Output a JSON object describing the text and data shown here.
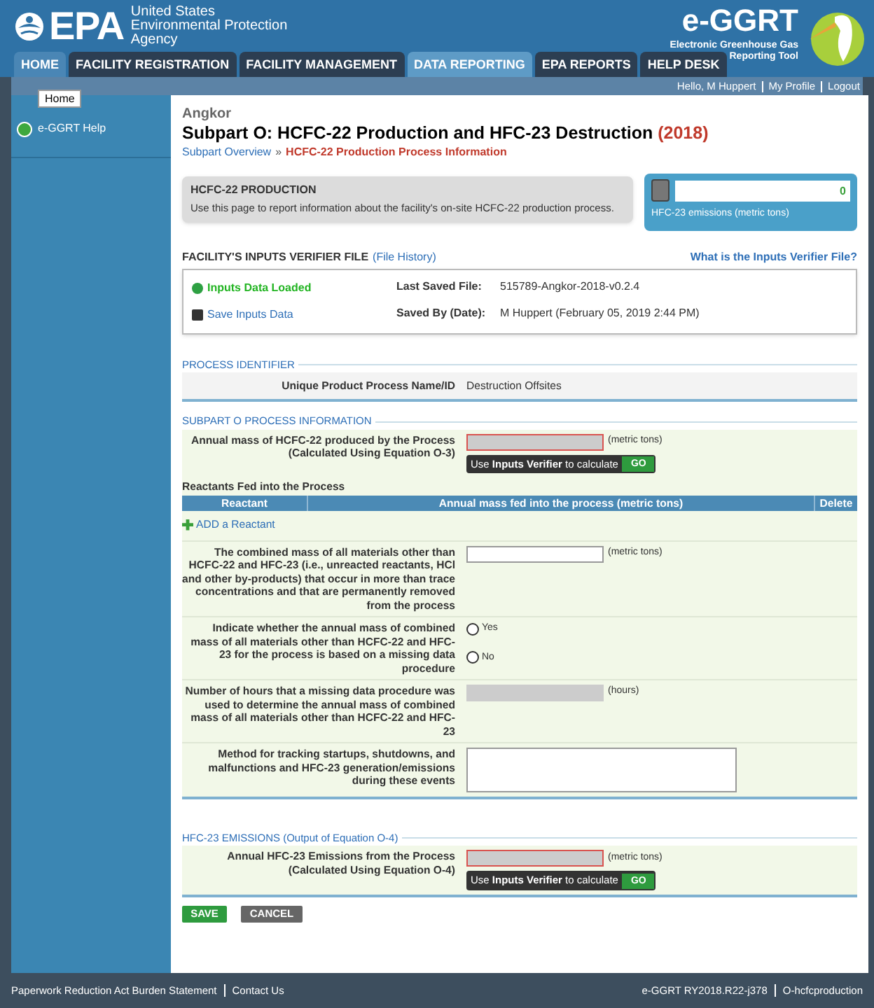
{
  "header": {
    "logo": "EPA",
    "agency": [
      "United States",
      "Environmental Protection",
      "Agency"
    ],
    "app_name": "e-GGRT",
    "app_subtitle": [
      "Electronic Greenhouse Gas",
      "Reporting Tool"
    ]
  },
  "tabs": [
    {
      "label": "HOME",
      "selected": false,
      "hovered": true
    },
    {
      "label": "FACILITY REGISTRATION",
      "selected": false,
      "hovered": false
    },
    {
      "label": "FACILITY MANAGEMENT",
      "selected": false,
      "hovered": false
    },
    {
      "label": "DATA REPORTING",
      "selected": true,
      "hovered": false
    },
    {
      "label": "EPA REPORTS",
      "selected": false,
      "hovered": false
    },
    {
      "label": "HELP DESK",
      "selected": false,
      "hovered": false
    }
  ],
  "tooltip": "Home",
  "user_links": [
    "Hello, M Huppert",
    "My Profile",
    "Logout"
  ],
  "sidebar": {
    "items": [
      {
        "label": "e-GGRT Help"
      }
    ]
  },
  "page": {
    "facility": "Angkor",
    "title": "Subpart O: HCFC-22 Production and HFC-23 Destruction",
    "year": "(2018)",
    "breadcrumb": {
      "link": "Subpart Overview",
      "separator": "»",
      "current": "HCFC-22 Production Process Information"
    }
  },
  "info_box": {
    "title": "HCFC-22 PRODUCTION",
    "text": "Use this page to report information about the facility's on-site HCFC-22 production process."
  },
  "emissions_widget": {
    "value": "0",
    "label": "HFC-23 emissions (metric tons)"
  },
  "verifier": {
    "heading": "FACILITY'S INPUTS VERIFIER FILE",
    "history_link": "(File History)",
    "help_link": "What is the Inputs Verifier File?",
    "status": "Inputs Data Loaded",
    "save_link": "Save Inputs Data",
    "fields": [
      {
        "label": "Last Saved File:",
        "value": "515789-Angkor-2018-v0.2.4"
      },
      {
        "label": "Saved By (Date):",
        "value": "M Huppert (February 05, 2019 2:44 PM)"
      }
    ]
  },
  "sections": [
    {
      "heading": "PROCESS IDENTIFIER",
      "rows": [
        {
          "kind": "static",
          "label": "Unique Product Process Name/ID",
          "value": "Destruction Offsites"
        }
      ]
    },
    {
      "heading": "SUBPART O PROCESS INFORMATION",
      "rows": [
        {
          "kind": "calc",
          "label": "Annual mass of HCFC-22 produced by the Process (Calculated Using Equation O-3)",
          "unit": "(metric tons)",
          "prompt": "Use **Inputs Verifier** to calculate",
          "button": "GO"
        },
        {
          "kind": "table",
          "title": "Reactants Fed into the Process",
          "columns": [
            "Reactant",
            "Annual mass fed into the process (metric tons)",
            "Delete"
          ],
          "add_link": "ADD a Reactant"
        },
        {
          "kind": "text",
          "label": "The combined mass of all materials other than HCFC-22 and HFC-23 (i.e., unreacted reactants, HCl and other by-products) that occur in more than trace concentrations and that are permanently removed from the process",
          "unit": "(metric tons)"
        },
        {
          "kind": "radio",
          "label": "Indicate whether the annual mass of combined mass of all materials other than HCFC-22 and HFC-23 for the process is based on a missing data procedure",
          "options": [
            {
              "label": "Yes",
              "selected": false
            },
            {
              "label": "No",
              "selected": false
            }
          ]
        },
        {
          "kind": "disabled",
          "label": "Number of hours that a missing data procedure was used to determine the annual mass of combined mass of all materials other than HCFC-22 and HFC-23",
          "unit": "(hours)"
        },
        {
          "kind": "textarea",
          "label": "Method for tracking startups, shutdowns, and malfunctions and HFC-23 generation/emissions during these events"
        }
      ]
    },
    {
      "heading": "HFC-23 EMISSIONS (Output of Equation O-4)",
      "rows": [
        {
          "kind": "calc",
          "label": "Annual HFC-23 Emissions from the Process (Calculated Using Equation O-4)",
          "unit": "(metric tons)",
          "prompt": "Use **Inputs Verifier** to calculate",
          "button": "GO"
        }
      ]
    }
  ],
  "buttons": [
    {
      "label": "SAVE",
      "kind": "primary"
    },
    {
      "label": "CANCEL",
      "kind": "secondary"
    }
  ],
  "footer": {
    "left": [
      "Paperwork Reduction Act Burden Statement",
      "Contact Us"
    ],
    "right": [
      "e-GGRT RY2018.R22-j378",
      "O-hcfcproduction"
    ]
  }
}
